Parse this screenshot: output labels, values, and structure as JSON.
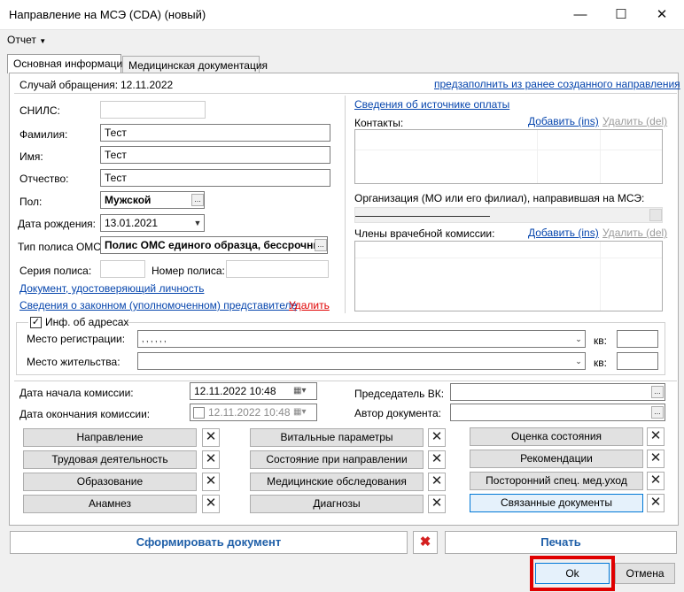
{
  "window": {
    "title": "Направление на МСЭ (CDA) (новый)"
  },
  "menu": {
    "report": "Отчет"
  },
  "tabs": [
    {
      "label": "Основная информация"
    },
    {
      "label": "Медицинская документация"
    }
  ],
  "case": {
    "label": "Случай обращения:",
    "date": "12.11.2022",
    "prefill_link": "предзаполнить из ранее созданного направления"
  },
  "patient": {
    "snils_label": "СНИЛС:",
    "snils": "",
    "last_name_label": "Фамилия:",
    "last_name": "Тест",
    "first_name_label": "Имя:",
    "first_name": "Тест",
    "middle_name_label": "Отчество:",
    "middle_name": "Тест",
    "sex_label": "Пол:",
    "sex": "Мужской",
    "birth_label": "Дата рождения:",
    "birth": "13.01.2021",
    "policy_type_label": "Тип полиса ОМС:",
    "policy_type": "Полис ОМС единого образца, бессрочный",
    "policy_series_label": "Серия полиса:",
    "policy_series": "",
    "policy_number_label": "Номер полиса:",
    "policy_number": ""
  },
  "links": {
    "identity_doc": "Документ, удостоверяющий личность",
    "representative": "Сведения о законном (уполномоченном) представителе",
    "delete": "Удалить",
    "payment_source": "Сведения об источнике оплаты"
  },
  "contacts": {
    "label": "Контакты:",
    "add": "Добавить (ins)",
    "delete": "Удалить (del)"
  },
  "organization": {
    "label": "Организация (МО или его филиал), направившая на МСЭ:"
  },
  "commission": {
    "label": "Члены врачебной комиссии:",
    "add": "Добавить (ins)",
    "delete": "Удалить (del)"
  },
  "addresses": {
    "group_label": "Инф. об адресах",
    "checked": true,
    "registration_label": "Место регистрации:",
    "registration": ",          ,          ,          ,          ,                    ,",
    "residence_label": "Место жительства:",
    "residence": "",
    "apt_label": "кв:",
    "apt_label2": "кв:",
    "apt1": "",
    "apt2": ""
  },
  "dates": {
    "start_label": "Дата начала комиссии:",
    "start": "12.11.2022 10:48",
    "end_label": "Дата окончания комиссии:",
    "end": "12.11.2022 10:48",
    "chair_label": "Председатель ВК:",
    "chair": "",
    "author_label": "Автор документа:",
    "author": ""
  },
  "sections": {
    "col1": [
      "Направление",
      "Трудовая деятельность",
      "Образование",
      "Анамнез"
    ],
    "col2": [
      "Витальные параметры",
      "Состояние при направлении",
      "Медицинские обследования",
      "Диагнозы"
    ],
    "col3": [
      "Оценка состояния",
      "Рекомендации",
      "Посторонний спец. мед.уход",
      "Связанные документы"
    ]
  },
  "footer": {
    "generate": "Сформировать документ",
    "print": "Печать",
    "ok": "Ok",
    "cancel": "Отмена"
  },
  "icons": {
    "close": "close-icon",
    "maximize": "maximize-icon",
    "minimize": "minimize-icon",
    "delete": "delete-x-icon"
  },
  "colors": {
    "link": "#0645ad",
    "delete_link": "#e00000",
    "highlight": "#e00000"
  }
}
